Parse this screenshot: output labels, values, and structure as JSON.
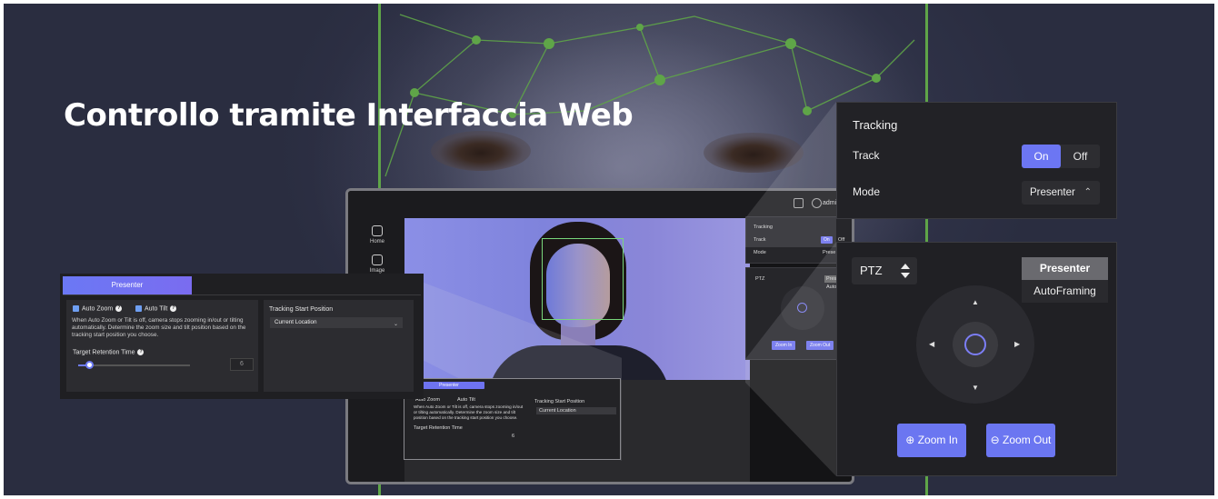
{
  "headline": "Controllo tramite Interfaccia Web",
  "monitor": {
    "admin": "admin",
    "sidebar": [
      {
        "label": "Home",
        "icon": "home-icon"
      },
      {
        "label": "Image",
        "icon": "image-icon"
      }
    ],
    "mini_tracking": {
      "title": "Tracking",
      "track_label": "Track",
      "on": "On",
      "off": "Off",
      "mode_label": "Mode",
      "mode_value": "Prese"
    },
    "mini_ptz": {
      "ptz": "PTZ",
      "presenter": "Pres",
      "auto": "Auto",
      "zoom_in": "Zoom In",
      "zoom_out": "Zoom Out"
    },
    "mini_presenter": {
      "tab": "Presenter",
      "auto_zoom": "Auto Zoom",
      "auto_tilt": "Auto Tilt",
      "desc": "When Auto Zoom or Tilt is off, camera stops zooming in/out or tilting automatically. Determine the zoom size and tilt position based on the tracking start position you choose.",
      "retention": "Target Retention Time",
      "value": "6",
      "start_pos": "Tracking Start Position",
      "location": "Current Location"
    }
  },
  "presenter_panel": {
    "tab": "Presenter",
    "auto_zoom": "Auto Zoom",
    "auto_tilt": "Auto Tilt",
    "description": "When Auto Zoom or Tilt is off, camera stops zooming in/out or tilting automatically. Determine the zoom size and tilt position based on the tracking start position you choose.",
    "retention_label": "Target Retention Time",
    "retention_value": "6",
    "retention_level": 0.1,
    "start_position_label": "Tracking Start Position",
    "start_position_value": "Current Location"
  },
  "tracking_panel": {
    "title": "Tracking",
    "track_label": "Track",
    "on": "On",
    "off": "Off",
    "track_state": "On",
    "mode_label": "Mode",
    "mode_value": "Presenter"
  },
  "ptz_panel": {
    "ptz_label": "PTZ",
    "options": [
      "Presenter",
      "AutoFraming"
    ],
    "selected": "Presenter",
    "zoom_in": "Zoom In",
    "zoom_out": "Zoom Out"
  },
  "colors": {
    "accent": "#6c76f3",
    "tracking_box": "#79d77c",
    "mesh_green": "#5fa548"
  }
}
